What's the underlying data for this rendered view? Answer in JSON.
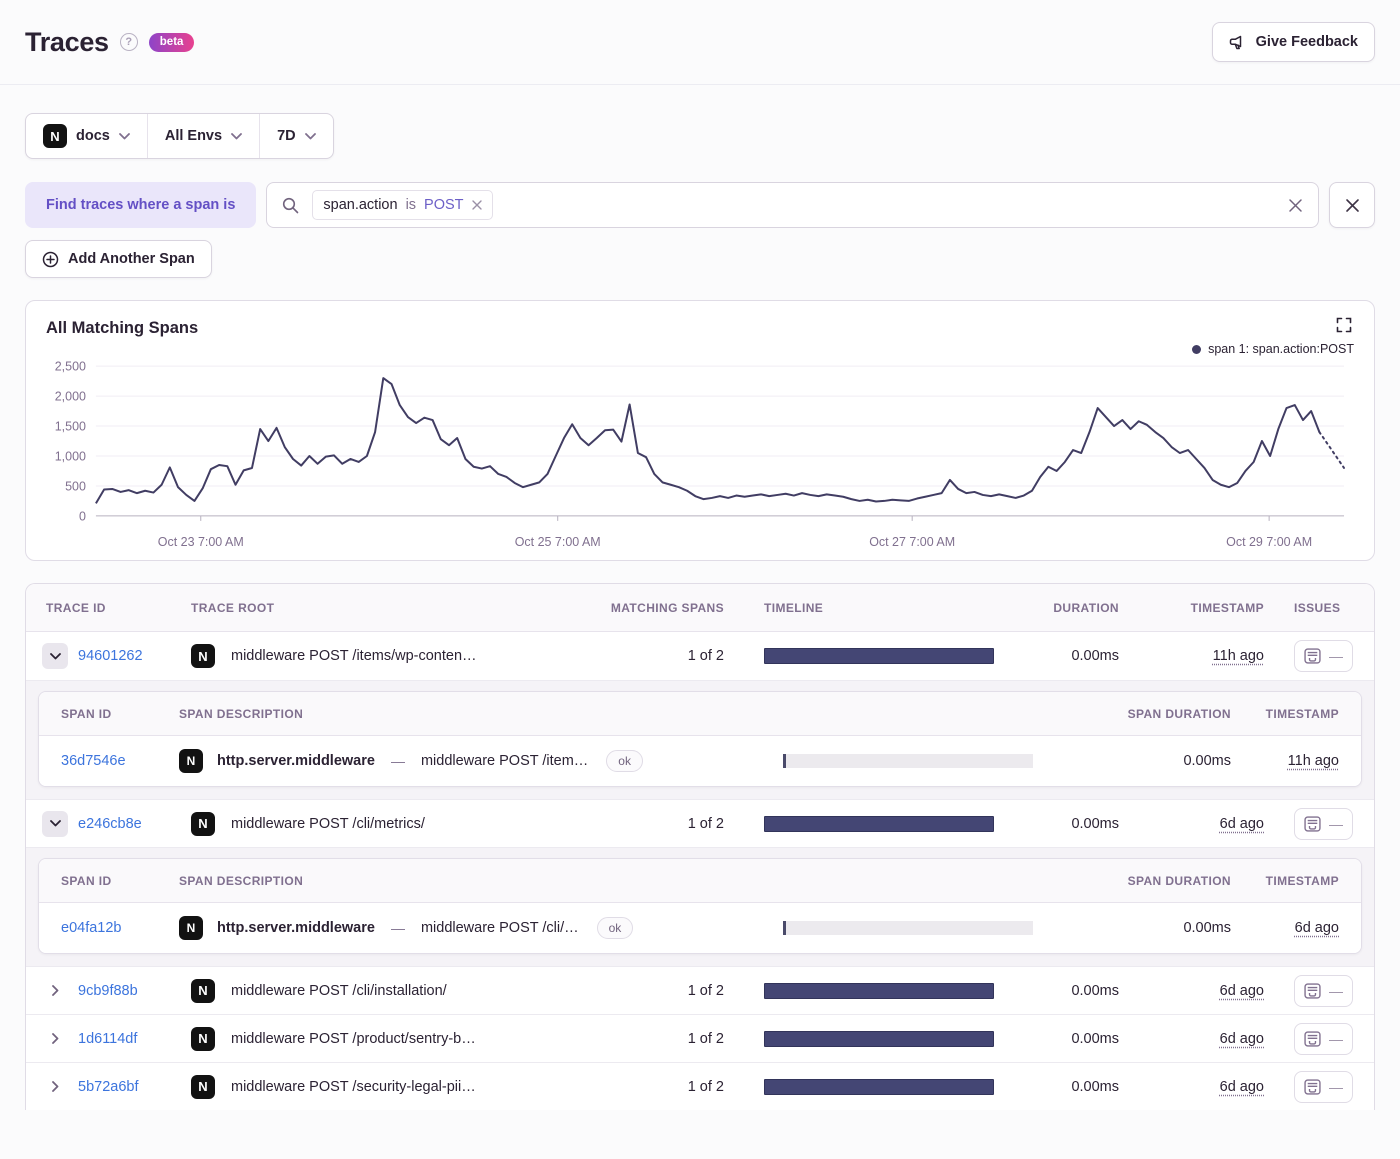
{
  "page": {
    "title": "Traces",
    "beta_label": "beta"
  },
  "header": {
    "feedback_button": "Give Feedback"
  },
  "filters": {
    "project_label": "docs",
    "env_label": "All Envs",
    "period_label": "7D"
  },
  "span_query": {
    "find_label": "Find traces where a span is",
    "token_key": "span.action",
    "token_op": "is",
    "token_value": "POST",
    "add_span_label": "Add Another Span"
  },
  "chart": {
    "title": "All Matching Spans",
    "legend_label": "span 1: span.action:POST"
  },
  "chart_data": {
    "type": "line",
    "title": "All Matching Spans",
    "series": [
      {
        "name": "span 1: span.action:POST",
        "values": [
          210,
          440,
          450,
          400,
          430,
          380,
          420,
          390,
          520,
          810,
          480,
          350,
          250,
          460,
          780,
          850,
          830,
          520,
          760,
          800,
          1450,
          1250,
          1470,
          1150,
          950,
          840,
          1000,
          870,
          990,
          1010,
          870,
          950,
          900,
          1000,
          1400,
          2300,
          2200,
          1850,
          1650,
          1550,
          1640,
          1600,
          1280,
          1180,
          1300,
          950,
          820,
          790,
          830,
          700,
          650,
          550,
          480,
          520,
          560,
          700,
          1000,
          1300,
          1530,
          1300,
          1180,
          1300,
          1430,
          1440,
          1240,
          1860,
          1050,
          980,
          700,
          560,
          520,
          480,
          420,
          330,
          280,
          300,
          330,
          300,
          340,
          320,
          340,
          360,
          330,
          350,
          370,
          340,
          380,
          350,
          330,
          360,
          340,
          320,
          280,
          250,
          270,
          240,
          250,
          270,
          260,
          250,
          290,
          320,
          350,
          380,
          600,
          450,
          380,
          400,
          350,
          330,
          360,
          330,
          300,
          340,
          420,
          650,
          820,
          750,
          900,
          1100,
          1050,
          1400,
          1800,
          1650,
          1500,
          1600,
          1450,
          1580,
          1520,
          1400,
          1300,
          1150,
          1050,
          1100,
          950,
          800,
          600,
          520,
          480,
          550,
          750,
          900,
          1250,
          1000,
          1450,
          1800,
          1850,
          1600,
          1750,
          1400,
          1200,
          1000,
          800
        ]
      }
    ],
    "ylim": [
      0,
      2500
    ],
    "y_tick_values": [
      0,
      500,
      1000,
      1500,
      2000,
      2500
    ],
    "y_tick_labels": [
      "0",
      "500",
      "1,000",
      "1,500",
      "2,000",
      "2,500"
    ],
    "x_ticks": [
      {
        "label": "Oct 23 7:00 AM",
        "f": 0.084
      },
      {
        "label": "Oct 25 7:00 AM",
        "f": 0.37
      },
      {
        "label": "Oct 27 7:00 AM",
        "f": 0.654
      },
      {
        "label": "Oct 29 7:00 AM",
        "f": 0.94
      }
    ],
    "dashed_tail_points": 3,
    "line_color": "#413d63",
    "grid": true,
    "legend_position": "top-right"
  },
  "table": {
    "headers": [
      "Trace ID",
      "Trace Root",
      "Matching Spans",
      "Timeline",
      "Duration",
      "Timestamp",
      "Issues"
    ],
    "span_headers": [
      "Span ID",
      "Span Description",
      "Span Duration",
      "Timestamp"
    ],
    "rows": [
      {
        "trace_id": "94601262",
        "expanded": true,
        "trace_root": "middleware POST /items/wp-conten…",
        "matching_spans": "1 of 2",
        "duration": "0.00ms",
        "timestamp": "11h ago",
        "issues": "—",
        "spans": [
          {
            "span_id": "36d7546e",
            "op": "http.server.middleware",
            "description": "middleware POST /item…",
            "status": "ok",
            "span_duration": "0.00ms",
            "timestamp": "11h ago"
          }
        ]
      },
      {
        "trace_id": "e246cb8e",
        "expanded": true,
        "trace_root": "middleware POST /cli/metrics/",
        "matching_spans": "1 of 2",
        "duration": "0.00ms",
        "timestamp": "6d ago",
        "issues": "—",
        "spans": [
          {
            "span_id": "e04fa12b",
            "op": "http.server.middleware",
            "description": "middleware POST /cli/…",
            "status": "ok",
            "span_duration": "0.00ms",
            "timestamp": "6d ago"
          }
        ]
      },
      {
        "trace_id": "9cb9f88b",
        "expanded": false,
        "trace_root": "middleware POST /cli/installation/",
        "matching_spans": "1 of 2",
        "duration": "0.00ms",
        "timestamp": "6d ago",
        "issues": "—",
        "spans": []
      },
      {
        "trace_id": "1d6114df",
        "expanded": false,
        "trace_root": "middleware POST /product/sentry-b…",
        "matching_spans": "1 of 2",
        "duration": "0.00ms",
        "timestamp": "6d ago",
        "issues": "—",
        "spans": []
      },
      {
        "trace_id": "5b72a6bf",
        "expanded": false,
        "trace_root": "middleware POST /security-legal-pii…",
        "matching_spans": "1 of 2",
        "duration": "0.00ms",
        "timestamp": "6d ago",
        "issues": "—",
        "spans": []
      }
    ]
  },
  "colors": {
    "accent_purple": "#6c5fc7",
    "link_blue": "#3c74dd",
    "bar_navy": "#444674",
    "line_navy": "#413d63",
    "beta_gradient_start": "#8e44c8",
    "beta_gradient_end": "#e8418f"
  }
}
